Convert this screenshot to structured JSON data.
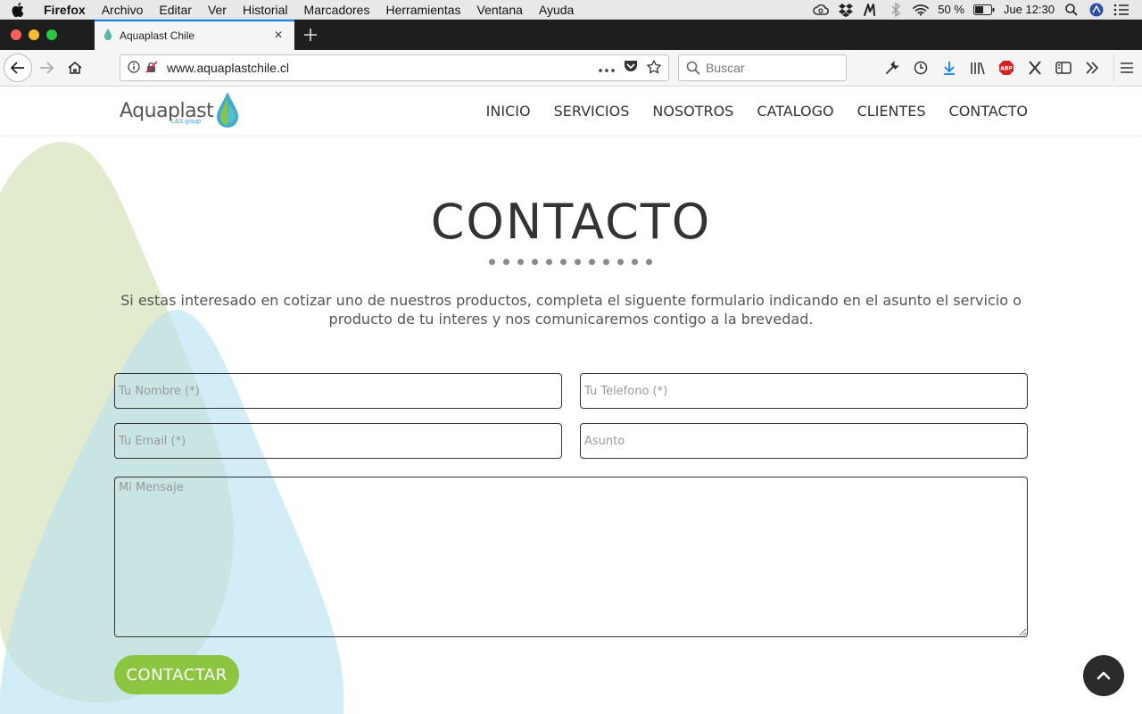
{
  "menubar": {
    "app": "Firefox",
    "items": [
      "Archivo",
      "Editar",
      "Ver",
      "Historial",
      "Marcadores",
      "Herramientas",
      "Ventana",
      "Ayuda"
    ],
    "battery": "50 %",
    "clock": "Jue 12:30"
  },
  "browser": {
    "tab_title": "Aquaplast Chile",
    "url": "www.aquaplastchile.cl",
    "search_placeholder": "Buscar"
  },
  "site": {
    "logo": {
      "brand": "Aquaplast",
      "sub": "L&S group"
    },
    "nav": [
      "INICIO",
      "SERVICIOS",
      "NOSOTROS",
      "CATALOGO",
      "CLIENTES",
      "CONTACTO"
    ],
    "heading": "CONTACTO",
    "intro": "Si estas interesado en cotizar uno de nuestros productos, completa el siguente formulario indicando en el asunto el servicio o producto de tu interes y nos comunicaremos contigo a la brevedad.",
    "form": {
      "nombre_placeholder": "Tu Nombre (*)",
      "telefono_placeholder": "Tu Telefono (*)",
      "email_placeholder": "Tu Email (*)",
      "asunto_placeholder": "Asunto",
      "mensaje_placeholder": "Mi Mensaje",
      "submit": "CONTACTAR"
    }
  },
  "colors": {
    "accent_green": "#8cc641",
    "shape_green": "#dfe9c8",
    "shape_blue": "#b8e2f0",
    "tab_highlight": "#0a84ff"
  }
}
